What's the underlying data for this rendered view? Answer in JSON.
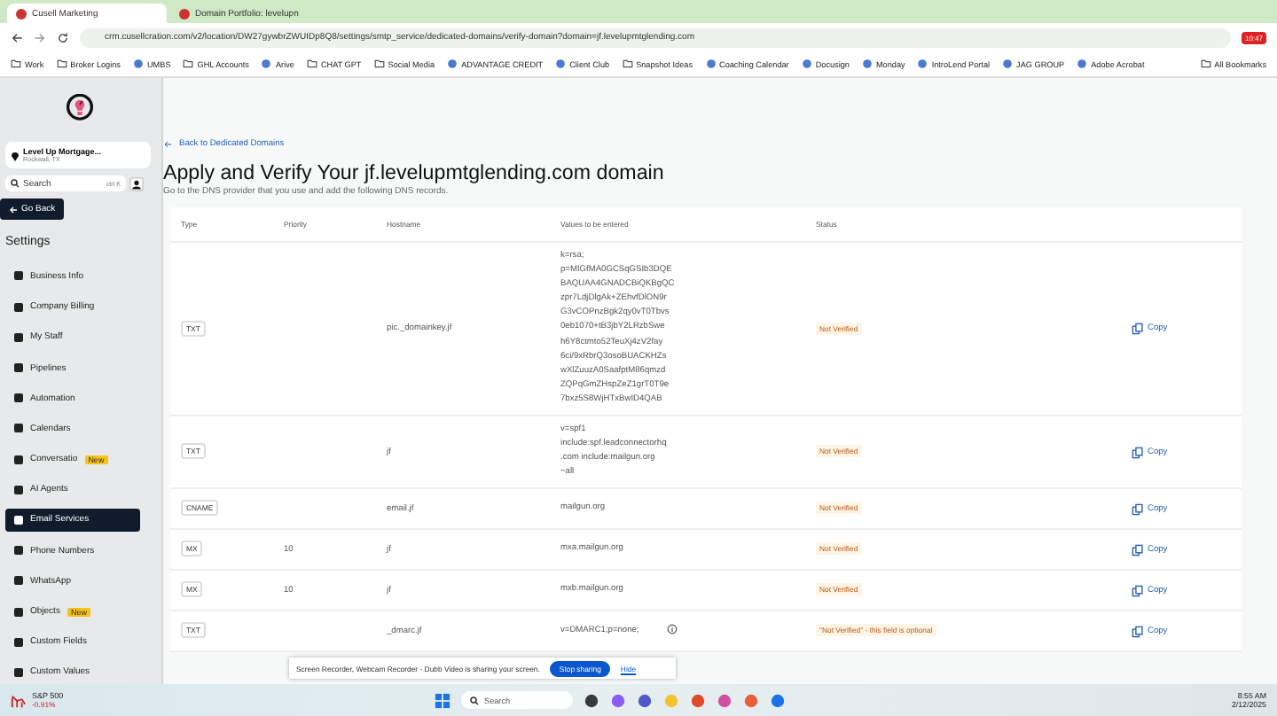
{
  "browser": {
    "tabs": [
      {
        "title": "Cusell Marketing",
        "selected": true
      },
      {
        "title": "Domain Portfolio: levelupn",
        "selected": false
      }
    ],
    "url": "crm.cusellcration.com/v2/location/DW27gywbrZWUIDp8Q8/settings/smtp_service/dedicated-domains/verify-domain?domain=jf.levelupmtglending.com",
    "extension_badge": "10:47",
    "bookmarks": [
      {
        "label": "Work",
        "kind": "folder"
      },
      {
        "label": "Broker Logins",
        "kind": "folder"
      },
      {
        "label": "UMBS",
        "kind": "site"
      },
      {
        "label": "GHL Accounts",
        "kind": "folder"
      },
      {
        "label": "Arive",
        "kind": "site"
      },
      {
        "label": "CHAT GPT",
        "kind": "folder"
      },
      {
        "label": "Social Media",
        "kind": "folder"
      },
      {
        "label": "ADVANTAGE CREDIT",
        "kind": "site"
      },
      {
        "label": "Client Club",
        "kind": "site"
      },
      {
        "label": "Snapshot Ideas",
        "kind": "folder"
      },
      {
        "label": "Coaching Calendar",
        "kind": "site"
      },
      {
        "label": "Docusign",
        "kind": "site"
      },
      {
        "label": "Monday",
        "kind": "site"
      },
      {
        "label": "IntroLend Portal",
        "kind": "site"
      },
      {
        "label": "JAG GROUP",
        "kind": "site"
      },
      {
        "label": "Adobe Acrobat",
        "kind": "site"
      }
    ],
    "all_bookmarks": "All Bookmarks"
  },
  "sidebar": {
    "location_name": "Level Up Mortgage...",
    "location_city": "Rockwall, TX",
    "search_placeholder": "Search",
    "search_shortcut": "ctrl K",
    "back_button": "Go Back",
    "section_title": "Settings",
    "items": [
      {
        "label": "Business Info",
        "selected": false
      },
      {
        "label": "Company Billing",
        "selected": false
      },
      {
        "label": "My Staff",
        "selected": false
      },
      {
        "label": "Pipelines",
        "selected": false
      },
      {
        "label": "Automation",
        "selected": false
      },
      {
        "label": "Calendars",
        "selected": false
      },
      {
        "label": "Conversatio",
        "selected": false,
        "badge": "New"
      },
      {
        "label": "AI Agents",
        "selected": false
      },
      {
        "label": "Email Services",
        "selected": true
      },
      {
        "label": "Phone Numbers",
        "selected": false
      },
      {
        "label": "WhatsApp",
        "selected": false
      },
      {
        "label": "Objects",
        "selected": false,
        "badge": "New"
      },
      {
        "label": "Custom Fields",
        "selected": false
      },
      {
        "label": "Custom Values",
        "selected": false
      }
    ]
  },
  "main": {
    "back_link": "Back to Dedicated Domains",
    "title": "Apply and Verify Your jf.levelupmtglending.com domain",
    "subtitle": "Go to the DNS provider that you use and add the following DNS records.",
    "table": {
      "columns": [
        "Type",
        "Priority",
        "Hostname",
        "Values to be entered",
        "Status"
      ],
      "rows": [
        {
          "type": "TXT",
          "priority": "",
          "hostname": "pic._domainkey.jf",
          "value_lines": [
            "k=rsa;",
            "p=MIGfMA0GCSqGSIb3DQE",
            "BAQUAA4GNADCBiQKBgQC",
            "zpr7LdjDlgAk+ZEhvfDlON9r",
            "G3vCOPnzBgk2qy0vT0Tbvs",
            "0eb1070+tB3jbY2LRzbSwe",
            "h6Y8ctmto52TeuXj4zV2fay",
            "6ci/9xRbrQ3osoBUACKHZs",
            "wXlZuuzA0SaafptM86qmzd",
            "ZQPqGmZHspZeZ1grT0T9e",
            "7bxz5S8WjHTxBwID4QAB"
          ],
          "status": "Not Verified",
          "info": false,
          "copy": "Copy"
        },
        {
          "type": "TXT",
          "priority": "",
          "hostname": "jf",
          "value_lines": [
            "v=spf1",
            "include:spf.leadconnectorhq",
            ".com include:mailgun.org",
            "~all"
          ],
          "status": "Not Verified",
          "info": false,
          "copy": "Copy"
        },
        {
          "type": "CNAME",
          "priority": "",
          "hostname": "email.jf",
          "value_lines": [
            "mailgun.org"
          ],
          "status": "Not Verified",
          "info": false,
          "copy": "Copy"
        },
        {
          "type": "MX",
          "priority": "10",
          "hostname": "jf",
          "value_lines": [
            "mxa.mailgun.org"
          ],
          "status": "Not Verified",
          "info": false,
          "copy": "Copy"
        },
        {
          "type": "MX",
          "priority": "10",
          "hostname": "jf",
          "value_lines": [
            "mxb.mailgun.org"
          ],
          "status": "Not Verified",
          "info": false,
          "copy": "Copy"
        },
        {
          "type": "TXT",
          "priority": "",
          "hostname": "_dmarc.jf",
          "value_lines": [
            "v=DMARC1;p=none;"
          ],
          "status": "\"Not Verified\" - this field is optional",
          "info": true,
          "copy": "Copy"
        }
      ]
    }
  },
  "share_bar": {
    "message": "Screen Recorder, Webcam Recorder - Dubb Video is sharing your screen.",
    "stop_button": "Stop sharing",
    "hide_link": "Hide"
  },
  "taskbar": {
    "stock_name": "S&P 500",
    "stock_change": "-0.91%",
    "search_placeholder": "Search",
    "time": "8:55 AM",
    "date": "2/12/2025"
  }
}
